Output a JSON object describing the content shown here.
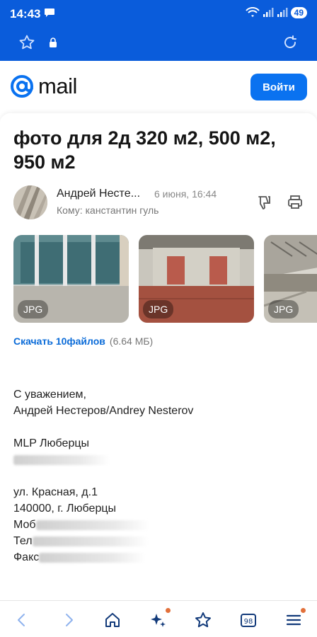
{
  "status": {
    "time": "14:43",
    "battery": "49"
  },
  "browser": {
    "url": "e.mail.ru"
  },
  "header": {
    "logo_text": "mail",
    "login_label": "Войти"
  },
  "email": {
    "subject": "фото для 2д 320 м2, 500 м2, 950 м2",
    "sender": "Андрей Нестe...",
    "date": "6 июня, 16:44",
    "to_label": "Кому:",
    "to_value": "канстантин гуль"
  },
  "attachments": [
    {
      "type": "JPG"
    },
    {
      "type": "JPG"
    },
    {
      "type": "JPG"
    }
  ],
  "download": {
    "label": "Скачать 10файлов",
    "size": "(6.64 МБ)"
  },
  "signature": {
    "greeting": "С уважением,",
    "name": "Андрей Нестеров/Andrey Nesterov",
    "company": "MLP Люберцы",
    "address_line1": "ул. Красная, д.1",
    "address_line2": "140000, г. Люберцы",
    "mobile_prefix": "Моб",
    "phone_prefix": "Тел",
    "fax_prefix": "Факс"
  },
  "colors": {
    "brand_blue": "#0a5cdb",
    "button_blue": "#0a72f0",
    "link_blue": "#0a6bd8"
  }
}
